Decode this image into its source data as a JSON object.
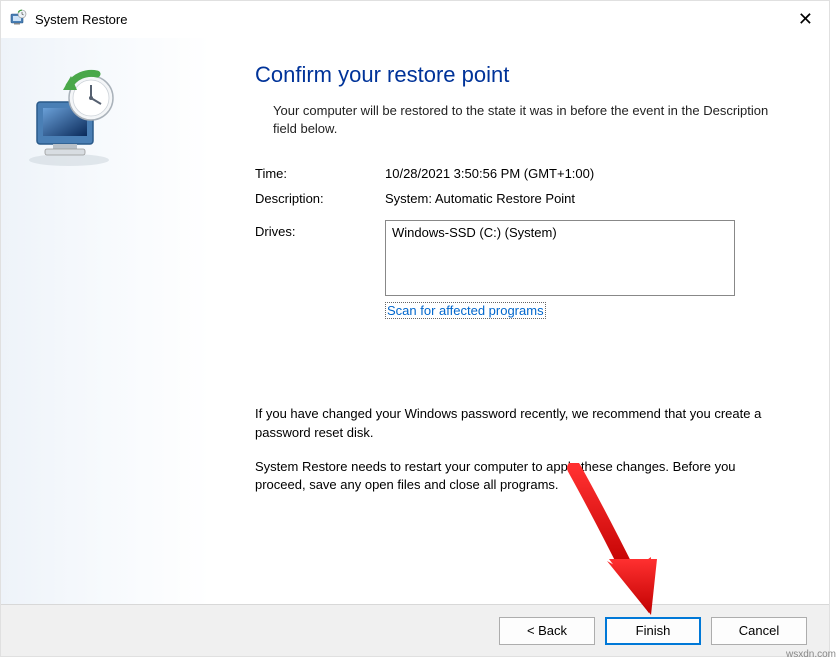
{
  "titlebar": {
    "title": "System Restore"
  },
  "main": {
    "heading": "Confirm your restore point",
    "subheading": "Your computer will be restored to the state it was in before the event in the Description field below.",
    "time_label": "Time:",
    "time_value": "10/28/2021 3:50:56 PM (GMT+1:00)",
    "description_label": "Description:",
    "description_value": "System: Automatic Restore Point",
    "drives_label": "Drives:",
    "drives_value": "Windows-SSD (C:) (System)",
    "scan_link": "Scan for affected programs",
    "password_note": "If you have changed your Windows password recently, we recommend that you create a password reset disk.",
    "restart_note": "System Restore needs to restart your computer to apply these changes. Before you proceed, save any open files and close all programs."
  },
  "footer": {
    "back_label": "< Back",
    "finish_label": "Finish",
    "cancel_label": "Cancel"
  },
  "watermark": "wsxdn.com"
}
